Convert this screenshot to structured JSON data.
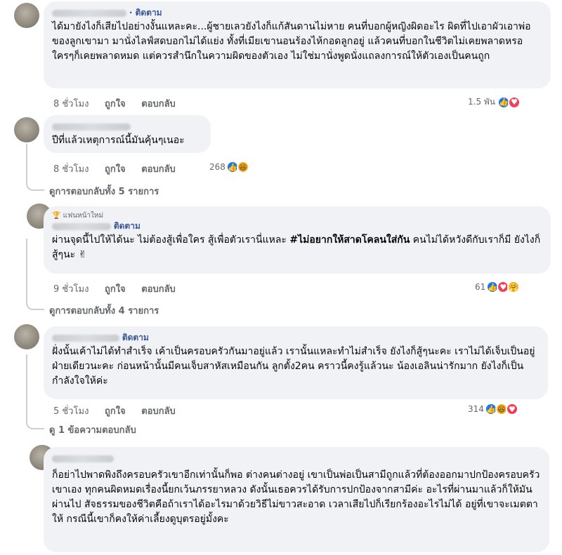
{
  "comments": [
    {
      "follow": "· ติดตาม",
      "text": "ได้มายังไงก็เสียไปอย่างงั้นแหละคะ...ผู้ชายเลวยังไงก็แก้สันดานไม่หาย คนที่บอกผู้หญิงผิดอะไร ผิดที่ไปเอาผัวเอาพ่อของลูกเขามา มานั่งไลฟ์สดบอกไม่ได้แย่ง ทั้งที่เมียเขานอนร้องไห้กอดลูกอยู่ แล้วคนที่บอกในชีวิตไม่เคยพลาดหรอ ใครๆก็เคยพลาดหมด แต่ควรสำนึกในความผิดของตัวเอง ไม่ใช่มานั่งพูดนั่งแถลงการณ์ให้ตัวเองเป็นคนถูก",
      "time": "8 ชั่วโมง",
      "like": "ถูกใจ",
      "reply": "ตอบกลับ",
      "reaction_count": "1.5 พัน"
    },
    {
      "text": "ปีที่แล้วเหตุการณ์นี้มันคุ้นๆเนอะ",
      "time": "8 ชั่วโมง",
      "like": "ถูกใจ",
      "reply": "ตอบกลับ",
      "reaction_count": "268",
      "see_replies": "ดูการตอบกลับทั้ง 5 รายการ"
    },
    {
      "badge": "แฟนหน้าใหม่",
      "follow": "ติดตาม",
      "text_before": "ผ่านจุดนี้ไปให้ได้นะ ไม่ต้องสู้เพื่อใคร สู้เพื่อตัวเรานี่แหละ ",
      "hashtag": "#ไม่อยากให้สาดโคลนใส่กัน",
      "text_after": " คนไม่ได้หวังดีกับเราก็มี ยังไงก็สู้ๆนะ ✌",
      "time": "9 ชั่วโมง",
      "like": "ถูกใจ",
      "reply": "ตอบกลับ",
      "reaction_count": "61",
      "see_replies": "ดูการตอบกลับทั้ง 4 รายการ"
    },
    {
      "follow": "ติดตาม",
      "text": "ฝั่งนั้นเค้าไม่ได้ทำสำเร็จ เค้าเป็นครอบครัวกันมาอยู่แล้ว เรานั้นแหละทำไม่สำเร็จ ยังไงก็สู้ๆนะคะ เราไม่ได้เจ็บเป็นอยู่ฝ่ายเดียวนะคะ ก่อนหน้านั้นมีคนเจ็บสาหัสเหมือนกัน ลูกตั้ง2คน คราวนี้คงรู้แล้วนะ น้องเอลินน่ารักมาก ยังไงก็เป็นกำลังใจให้ค่ะ",
      "time": "5 ชั่วโมง",
      "like": "ถูกใจ",
      "reply": "ตอบกลับ",
      "reaction_count": "314",
      "see_replies": "ดู 1 ข้อความตอบกลับ"
    },
    {
      "text": "ก็อย่าไปพาดพิงถึงครอบครัวเขาอีกเท่านั้นก็พอ ต่างคนต่างอยู่ เขาเป็นพ่อเป็นสามีถูกแล้วที่ต้องออกมาปกป้องครอบครัวเขาเอง ทุกคนผิดหมดเรื่องนี้ยกเว้นภรรยาหลวง ดังนั้นเธอควรได้รับการปกป้องจากสามีค่ะ อะไรที่ผ่านมาแล้วก็ให้มันผ่านไป สัจธรรมของชีวิตคือถ้าเราได้อะไรมาด้วยวิธีไม่ขาวสะอาด เวลาเสียไปก็เรียกร้องอะไรไม่ได้ อยู่ที่เขาจะเมตตาให้ กรณีนี้เขาก็คงให้ค่าเลี้ยงดูบุตรอยู่มั้งคะ"
    }
  ],
  "icons": {
    "like": "thumbs-up-icon",
    "love": "heart-icon",
    "haha": "laugh-icon",
    "care": "care-icon"
  },
  "colors": {
    "bubble": "#f0f2f5",
    "link": "#385898",
    "meta": "#65676b",
    "like": "#1877f2",
    "love": "#f33e58"
  }
}
